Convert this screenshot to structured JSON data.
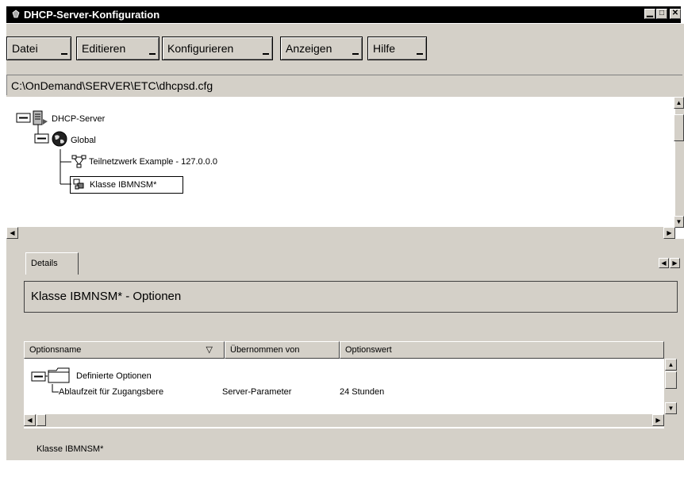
{
  "window": {
    "title": "DHCP-Server-Konfiguration"
  },
  "menu": {
    "items": [
      "Datei",
      "Editieren",
      "Konfigurieren",
      "Anzeigen",
      "Hilfe"
    ]
  },
  "path": {
    "value": "C:\\OnDemand\\SERVER\\ETC\\dhcpsd.cfg"
  },
  "tree": {
    "root": "DHCP-Server",
    "global": "Global",
    "subnet": "Teilnetzwerk Example - 127.0.0.0",
    "class": "Klasse IBMNSM*"
  },
  "details": {
    "tab": "Details",
    "header": "Klasse IBMNSM* - Optionen",
    "columns": [
      "Optionsname",
      "Übernommen von",
      "Optionswert"
    ],
    "group": "Definierte Optionen",
    "row": {
      "name": "Ablaufzeit für Zugangsbere",
      "from": "Server-Parameter",
      "value": "24 Stunden"
    }
  },
  "status": {
    "text": "Klasse IBMNSM*"
  },
  "colors": {
    "titlebar": "#000000",
    "chrome": "#d4d0c8",
    "selection_border": "#000000"
  }
}
